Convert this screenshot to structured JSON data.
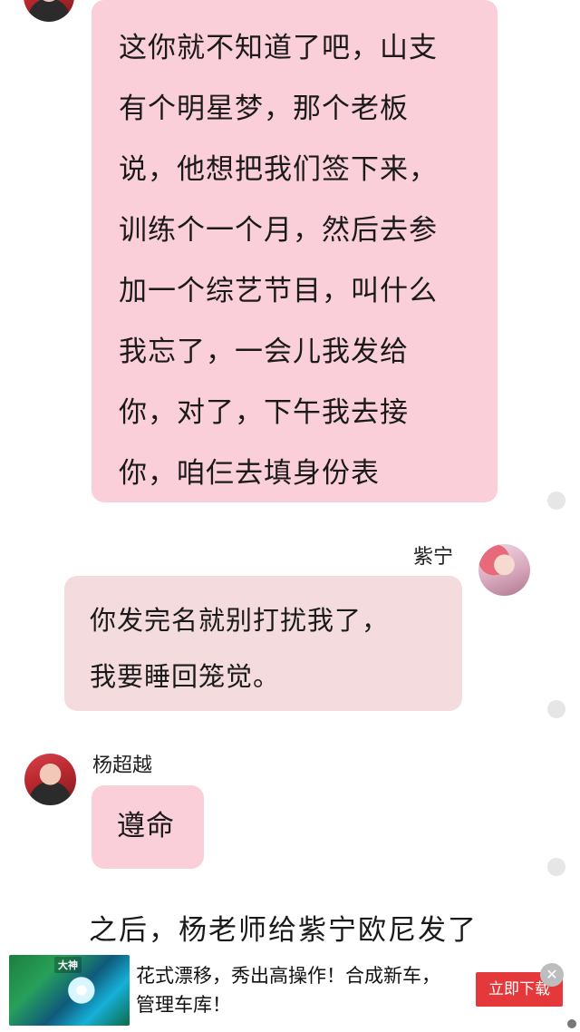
{
  "messages": {
    "first": {
      "lines": [
        "这你就不知道了吧，山支",
        "有个明星梦，那个老板",
        "说，他想把我们签下来，",
        "训练个一个月，然后去参",
        "加一个综艺节目，叫什么",
        "我忘了，一会儿我发给",
        "你，对了，下午我去接",
        "你，咱仨去填身份表"
      ]
    },
    "second": {
      "sender": "紫宁",
      "lines": [
        "你发完名就别打扰我了，",
        "我要睡回笼觉。"
      ]
    },
    "third": {
      "sender": "杨超越",
      "text": "遵命"
    }
  },
  "narration": "之后，杨老师给紫宁欧尼发了",
  "ad": {
    "thumb_label": "大神",
    "title": "花式漂移，秀出高操作！合成新车，管理车库！",
    "button": "立即下载",
    "close_icon": "close-icon"
  }
}
